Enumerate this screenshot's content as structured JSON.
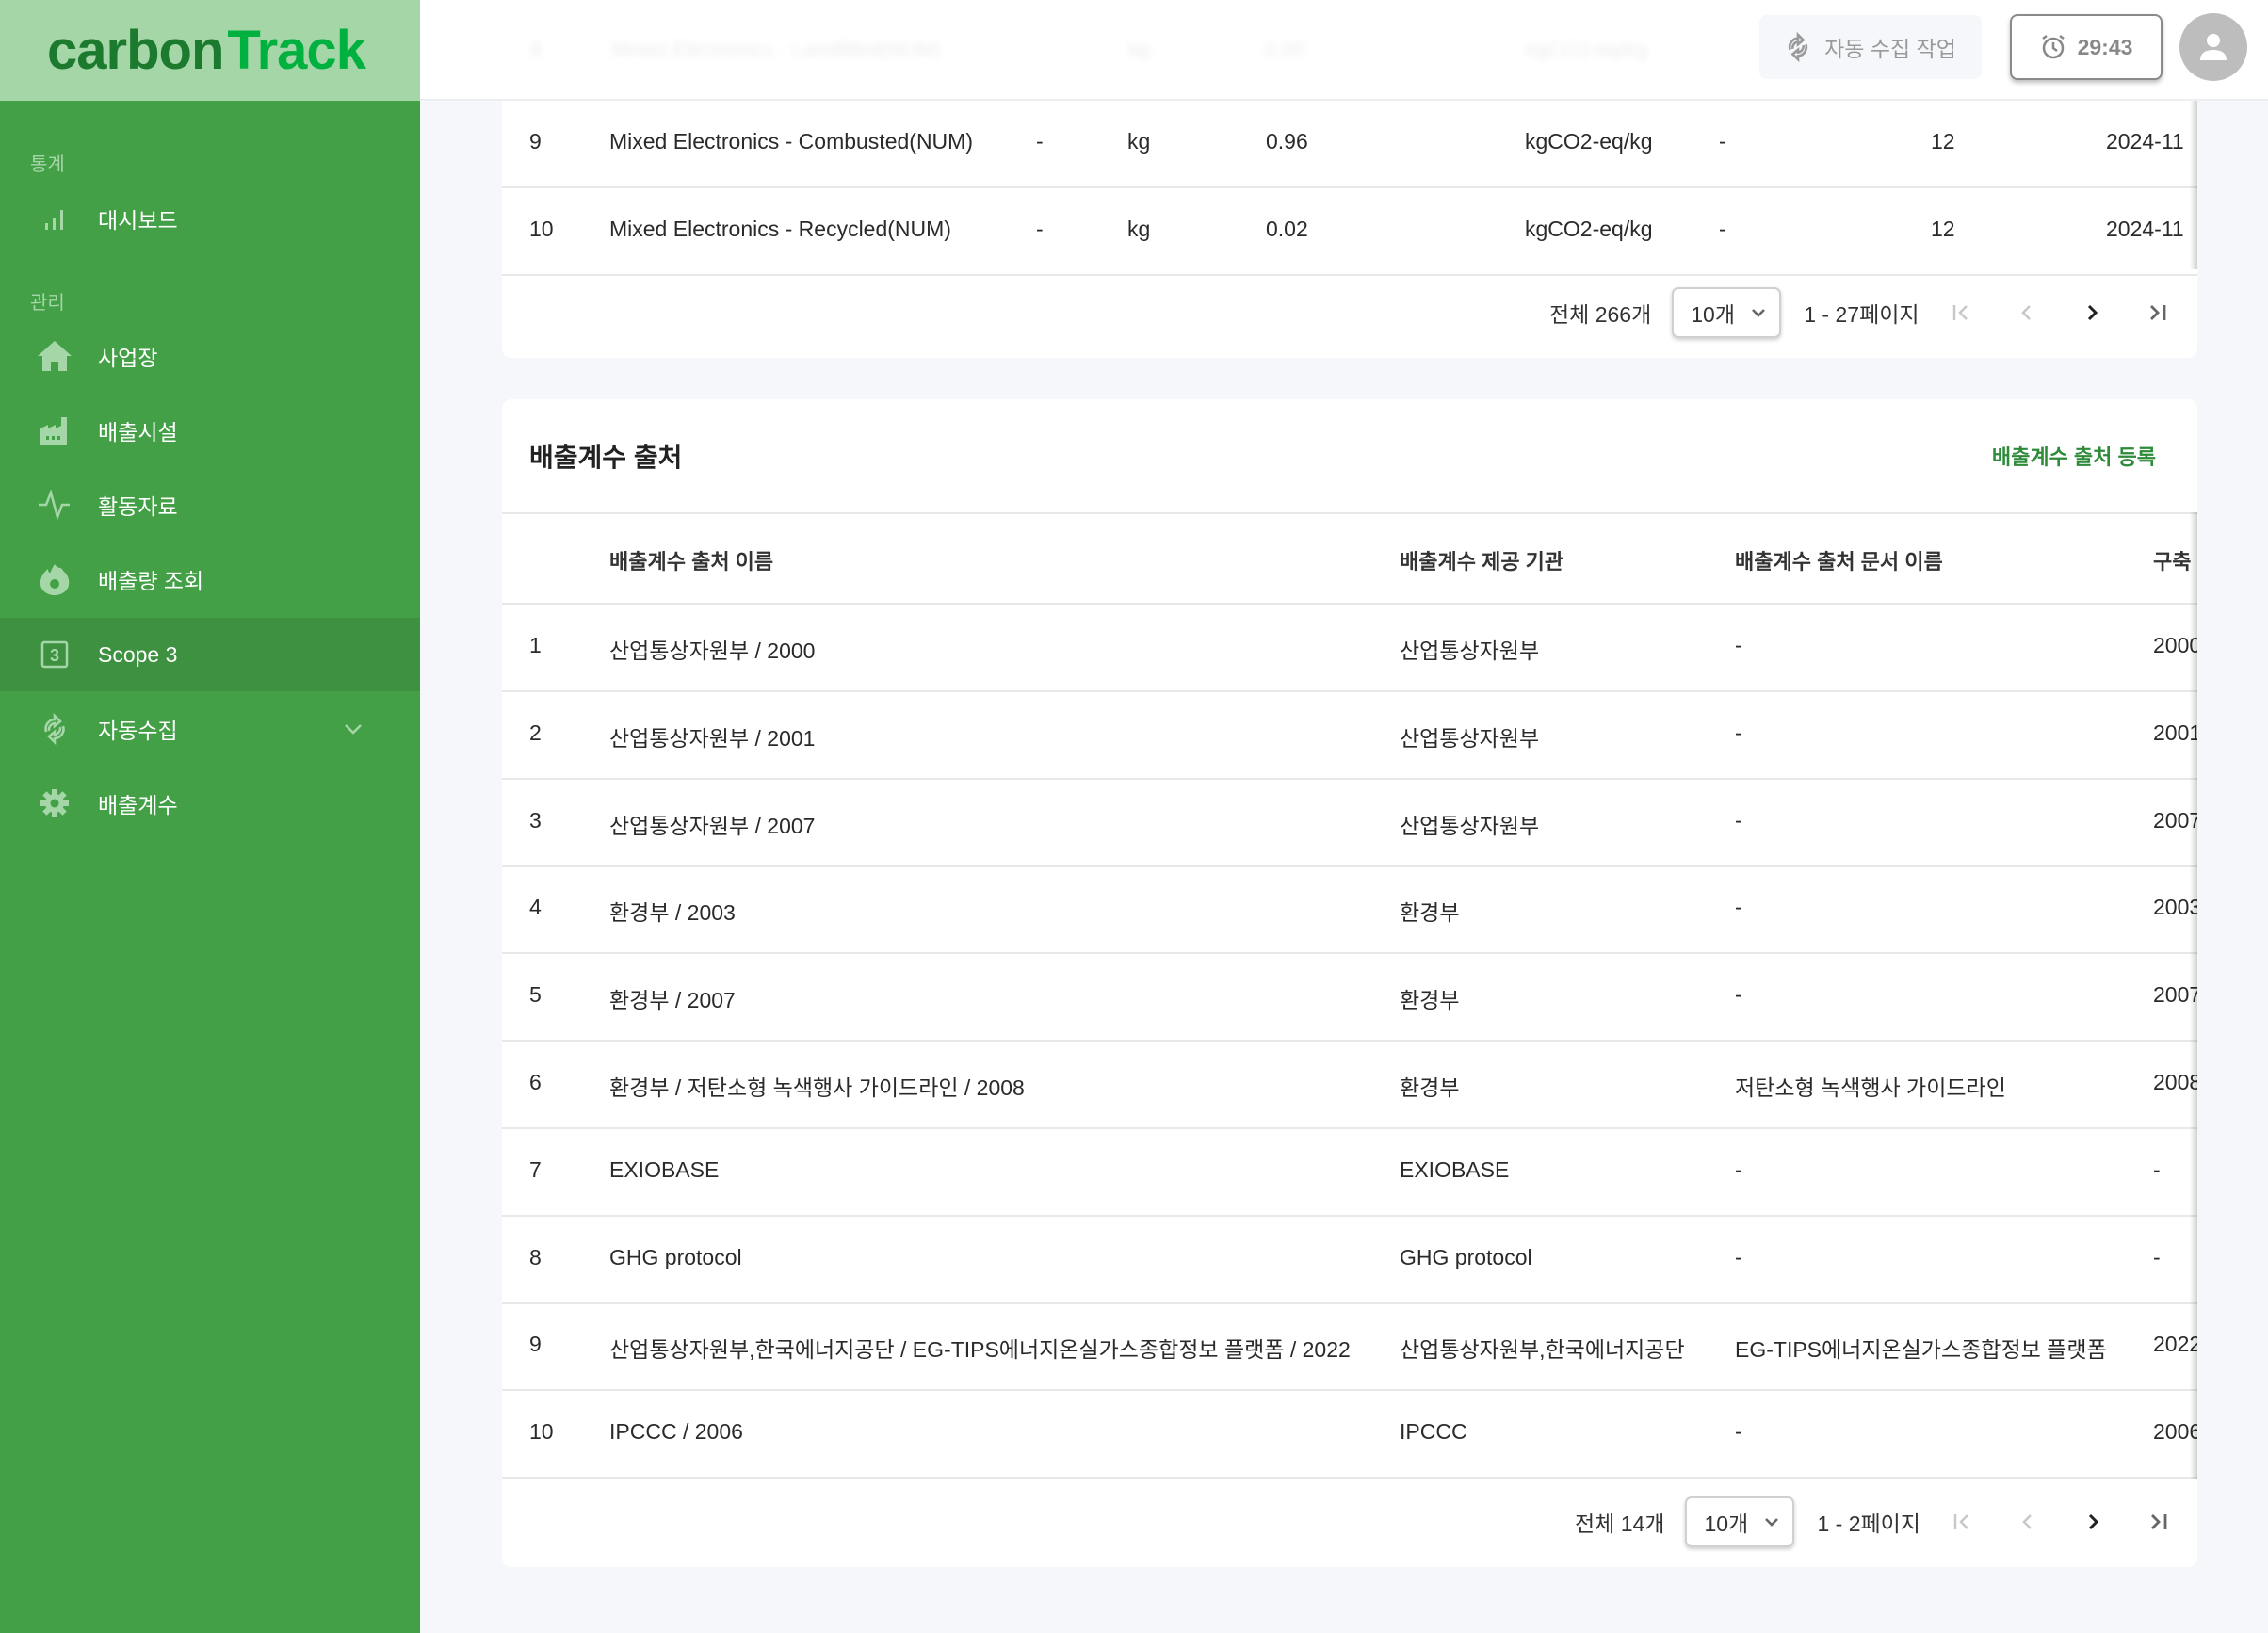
{
  "app": {
    "logo_part1": "carbon",
    "logo_part2": "Track",
    "brand_colors": {
      "sidebar": "#43a047",
      "logo_bg": "#a5d6a7",
      "logo_dark": "#1b7a2e",
      "logo_light": "#00b140",
      "link": "#2e8b3a"
    }
  },
  "sidebar": {
    "sections": [
      {
        "label": "통계"
      },
      {
        "label": "관리"
      }
    ],
    "items": [
      {
        "label": "대시보드",
        "icon": "bar-chart-icon"
      },
      {
        "label": "사업장",
        "icon": "home-icon"
      },
      {
        "label": "배출시설",
        "icon": "factory-icon"
      },
      {
        "label": "활동자료",
        "icon": "activity-icon"
      },
      {
        "label": "배출량 조회",
        "icon": "flame-icon"
      },
      {
        "label": "Scope 3",
        "icon": "scope3-icon",
        "active": true
      },
      {
        "label": "자동수집",
        "icon": "sync-icon",
        "expandable": true
      },
      {
        "label": "배출계수",
        "icon": "gear-icon"
      }
    ]
  },
  "header": {
    "auto_collect_label": "자동 수집 작업",
    "timer": "29:43"
  },
  "factor_table": {
    "rows": [
      {
        "no": "9",
        "name": "Mixed Electronics - Combusted(NUM)",
        "c3": "-",
        "unit": "kg",
        "value": "0.96",
        "factor_unit": "kgCO2-eq/kg",
        "c7": "-",
        "c8": "12",
        "date": "2024-11"
      },
      {
        "no": "10",
        "name": "Mixed Electronics - Recycled(NUM)",
        "c3": "-",
        "unit": "kg",
        "value": "0.02",
        "factor_unit": "kgCO2-eq/kg",
        "c7": "-",
        "c8": "12",
        "date": "2024-11"
      }
    ],
    "pagination": {
      "total": "전체 266개",
      "page_size": "10개",
      "range": "1 - 27페이지"
    }
  },
  "source_card": {
    "title": "배출계수 출처",
    "register_label": "배출계수 출처 등록",
    "columns": [
      "",
      "배출계수 출처 이름",
      "배출계수 제공 기관",
      "배출계수 출처 문서 이름",
      "구축"
    ],
    "rows": [
      {
        "no": "1",
        "name": "산업통상자원부 / 2000",
        "provider": "산업통상자원부",
        "doc": "-",
        "year": "2000"
      },
      {
        "no": "2",
        "name": "산업통상자원부 / 2001",
        "provider": "산업통상자원부",
        "doc": "-",
        "year": "2001"
      },
      {
        "no": "3",
        "name": "산업통상자원부 / 2007",
        "provider": "산업통상자원부",
        "doc": "-",
        "year": "2007"
      },
      {
        "no": "4",
        "name": "환경부 / 2003",
        "provider": "환경부",
        "doc": "-",
        "year": "2003"
      },
      {
        "no": "5",
        "name": "환경부 / 2007",
        "provider": "환경부",
        "doc": "-",
        "year": "2007"
      },
      {
        "no": "6",
        "name": "환경부 / 저탄소형 녹색행사 가이드라인 / 2008",
        "provider": "환경부",
        "doc": "저탄소형 녹색행사 가이드라인",
        "year": "2008"
      },
      {
        "no": "7",
        "name": "EXIOBASE",
        "provider": "EXIOBASE",
        "doc": "-",
        "year": "-"
      },
      {
        "no": "8",
        "name": "GHG protocol",
        "provider": "GHG protocol",
        "doc": "-",
        "year": "-"
      },
      {
        "no": "9",
        "name": "산업통상자원부,한국에너지공단 / EG-TIPS에너지온실가스종합정보 플랫폼 / 2022",
        "provider": "산업통상자원부,한국에너지공단",
        "doc": "EG-TIPS에너지온실가스종합정보 플랫폼",
        "year": "2022"
      },
      {
        "no": "10",
        "name": "IPCCC / 2006",
        "provider": "IPCCC",
        "doc": "-",
        "year": "2006"
      }
    ],
    "pagination": {
      "total": "전체 14개",
      "page_size": "10개",
      "range": "1 - 2페이지"
    }
  }
}
